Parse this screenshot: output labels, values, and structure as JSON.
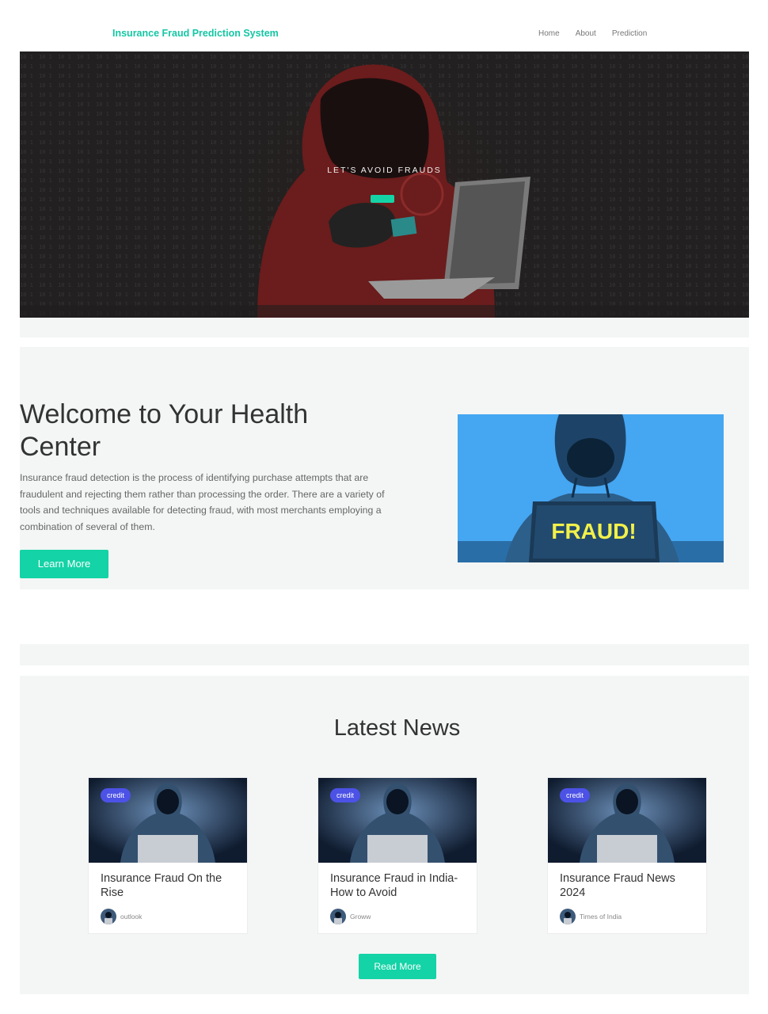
{
  "nav": {
    "brand": "Insurance Fraud Prediction System",
    "links": [
      "Home",
      "About",
      "Prediction"
    ]
  },
  "hero": {
    "tagline": "LET'S AVOID FRAUDS"
  },
  "welcome": {
    "title": "Welcome to Your Health Center",
    "body": "Insurance fraud detection is the process of identifying purchase attempts that are fraudulent and rejecting them rather than processing the order. There are a variety of tools and techniques available for detecting fraud, with most merchants employing a combination of several of them.",
    "button": "Learn More",
    "image_text": "FRAUD!"
  },
  "news": {
    "heading": "Latest News",
    "cards": [
      {
        "badge": "credit",
        "title": "Insurance Fraud On the Rise",
        "source": "outlook"
      },
      {
        "badge": "credit",
        "title": "Insurance Fraud in India- How to Avoid",
        "source": "Groww"
      },
      {
        "badge": "credit",
        "title": "Insurance Fraud News 2024",
        "source": "Times of India"
      }
    ],
    "button": "Read More"
  },
  "colors": {
    "accent": "#14d3a6",
    "badge": "#4c52e6",
    "section_bg": "#f3f6f5",
    "hero_bg": "#252424",
    "fraud_image_bg": "#45a6f2"
  }
}
